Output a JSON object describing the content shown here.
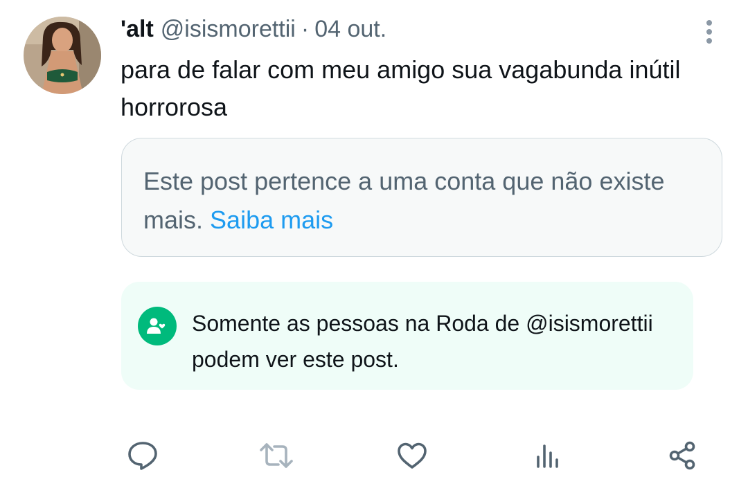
{
  "post": {
    "display_name": "'alt",
    "handle": "@isismorettii",
    "separator": "·",
    "date": "04 out.",
    "text": "para de falar com meu amigo sua vagabunda inútil horrorosa"
  },
  "removed_notice": {
    "text": "Este post pertence a uma conta que não existe mais.",
    "link": "Saiba mais"
  },
  "circle_notice": {
    "text": "Somente as pessoas na Roda de @isismorettii podem ver este post."
  },
  "actions": {
    "icons": [
      "reply-icon",
      "retweet-icon",
      "like-icon",
      "views-icon",
      "share-icon"
    ]
  },
  "colors": {
    "text_primary": "#0f1419",
    "text_secondary": "#536471",
    "link": "#1d9bf0",
    "circle_green": "#00ba7c",
    "circle_bg": "#effdf8",
    "box_bg": "#f7f9f9",
    "border": "#cfd9de"
  }
}
